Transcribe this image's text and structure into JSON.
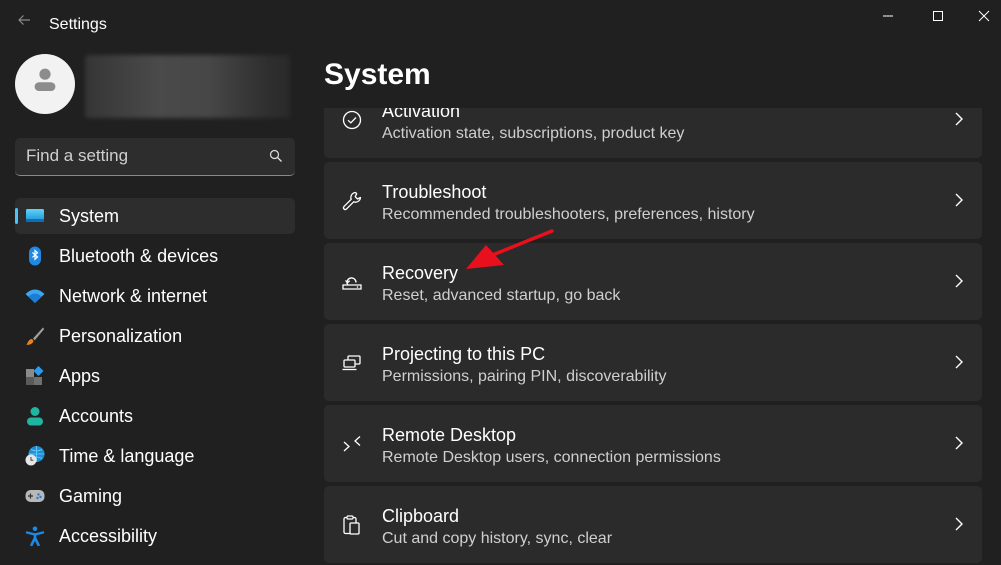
{
  "window": {
    "title": "Settings",
    "controls": {
      "minimize": "minimize",
      "maximize": "maximize",
      "close": "close"
    }
  },
  "profile": {
    "name_redacted": true
  },
  "search": {
    "placeholder": "Find a setting",
    "value": ""
  },
  "sidebar": {
    "items": [
      {
        "label": "System",
        "icon": "system-icon",
        "active": true
      },
      {
        "label": "Bluetooth & devices",
        "icon": "bluetooth-icon",
        "active": false
      },
      {
        "label": "Network & internet",
        "icon": "wifi-icon",
        "active": false
      },
      {
        "label": "Personalization",
        "icon": "brush-icon",
        "active": false
      },
      {
        "label": "Apps",
        "icon": "apps-icon",
        "active": false
      },
      {
        "label": "Accounts",
        "icon": "person-icon",
        "active": false
      },
      {
        "label": "Time & language",
        "icon": "globe-clock-icon",
        "active": false
      },
      {
        "label": "Gaming",
        "icon": "gamepad-icon",
        "active": false
      },
      {
        "label": "Accessibility",
        "icon": "accessibility-icon",
        "active": false
      }
    ]
  },
  "main": {
    "title": "System",
    "cards": [
      {
        "title": "Activation",
        "description": "Activation state, subscriptions, product key",
        "icon": "check-circle-icon"
      },
      {
        "title": "Troubleshoot",
        "description": "Recommended troubleshooters, preferences, history",
        "icon": "wrench-icon"
      },
      {
        "title": "Recovery",
        "description": "Reset, advanced startup, go back",
        "icon": "recovery-icon"
      },
      {
        "title": "Projecting to this PC",
        "description": "Permissions, pairing PIN, discoverability",
        "icon": "projecting-icon"
      },
      {
        "title": "Remote Desktop",
        "description": "Remote Desktop users, connection permissions",
        "icon": "remote-desktop-icon"
      },
      {
        "title": "Clipboard",
        "description": "Cut and copy history, sync, clear",
        "icon": "clipboard-icon"
      }
    ]
  },
  "colors": {
    "accent": "#4cc2ff",
    "background": "#202020",
    "card": "#2b2b2b",
    "annotation_arrow": "#e8101c"
  }
}
